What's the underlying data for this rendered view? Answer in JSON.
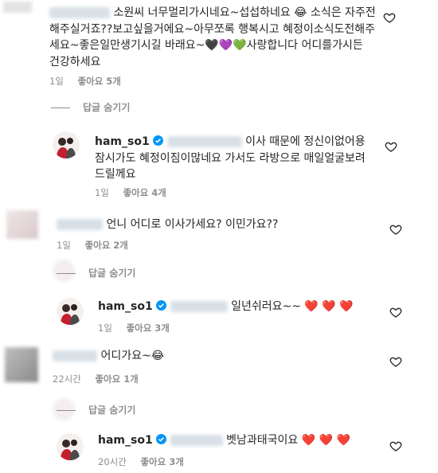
{
  "comments": [
    {
      "text": "소원씨 너무멀리가시네요~섭섭하네요 😂 소식은 자주전해주실거죠??보고싶을거에요~아무쪼록 행복시고 혜정이소식도전해주세요~좋은일만생기시길 바래요~🖤💜💚사랑합니다 어디를가시든 건강하세요",
      "time": "1일",
      "likes": "좋아요 5개",
      "hide": "답글 숨기기",
      "reply": {
        "user": "ham_so1",
        "text": "이사 때문에 정신이없어용 잠시가도 혜정이짐이많네요 가서도 라방으로 매일얼굴보려드릴께요",
        "time": "1일",
        "likes": "좋아요 4개"
      }
    },
    {
      "text": "언니 어디로 이사가세요? 이민가요??",
      "time": "1일",
      "likes": "좋아요 2개",
      "hide": "답글 숨기기",
      "reply": {
        "user": "ham_so1",
        "text": "일년쉬러요~~",
        "hearts": "❤️ ❤️ ❤️",
        "time": "1일",
        "likes": "좋아요 3개"
      }
    },
    {
      "text": "어디가요~😂",
      "time": "22시간",
      "likes": "좋아요 1개",
      "hide": "답글 숨기기",
      "reply": {
        "user": "ham_so1",
        "text": "벳남과태국이요",
        "hearts": "❤️ ❤️ ❤️",
        "time": "20시간",
        "likes": "좋아요 3개"
      }
    }
  ],
  "icons": {
    "like": "heart-outline-icon",
    "verified": "verified-badge-icon"
  },
  "colors": {
    "text": "#262626",
    "muted": "#8e8e8e",
    "verified": "#0095f6",
    "heart": "#ed1b39"
  }
}
